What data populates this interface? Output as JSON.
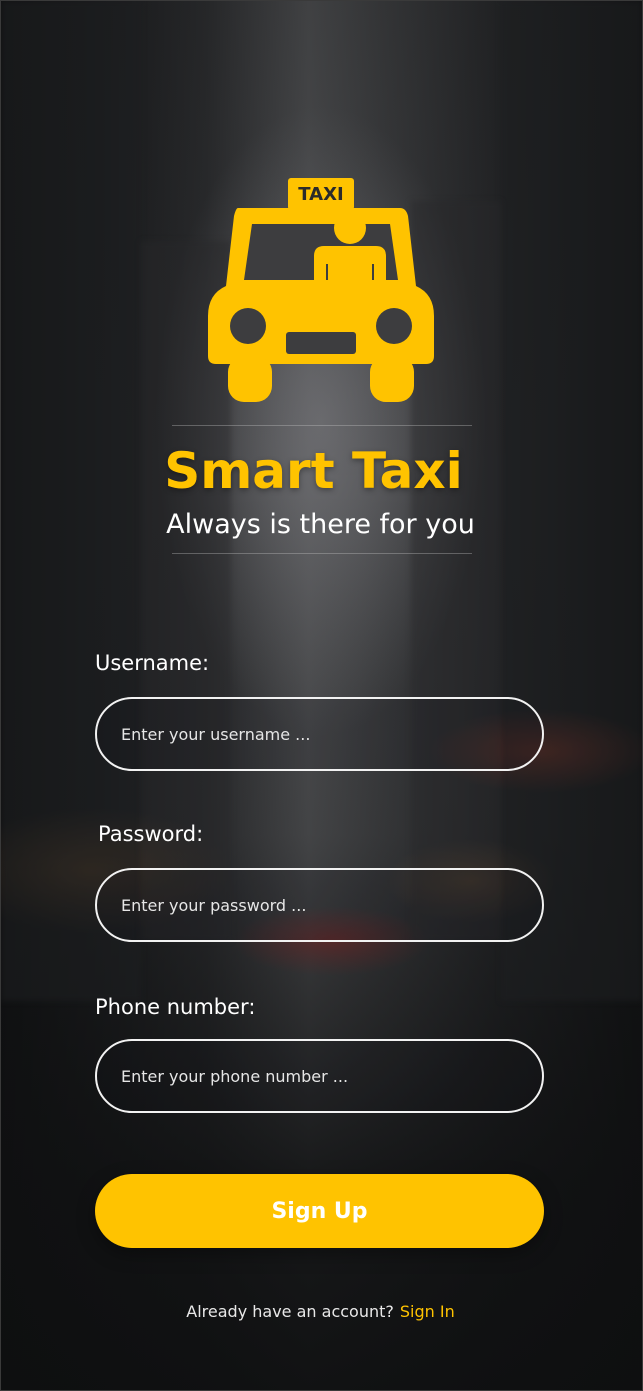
{
  "app": {
    "title": "Smart Taxi",
    "tagline": "Always is there for you",
    "logo_icon": "taxi-icon",
    "logo_badge_text": "TAXI"
  },
  "form": {
    "username": {
      "label": "Username:",
      "placeholder": "Enter your username ..."
    },
    "password": {
      "label": "Password:",
      "placeholder": "Enter your password ..."
    },
    "phone": {
      "label": "Phone number:",
      "placeholder": "Enter your phone number ..."
    },
    "submit_label": "Sign Up"
  },
  "footer": {
    "prompt": "Already have an account?",
    "link_label": "Sign In"
  },
  "colors": {
    "accent": "#FFC300",
    "text": "#FFFFFF",
    "input_border": "#F2F2F2"
  }
}
